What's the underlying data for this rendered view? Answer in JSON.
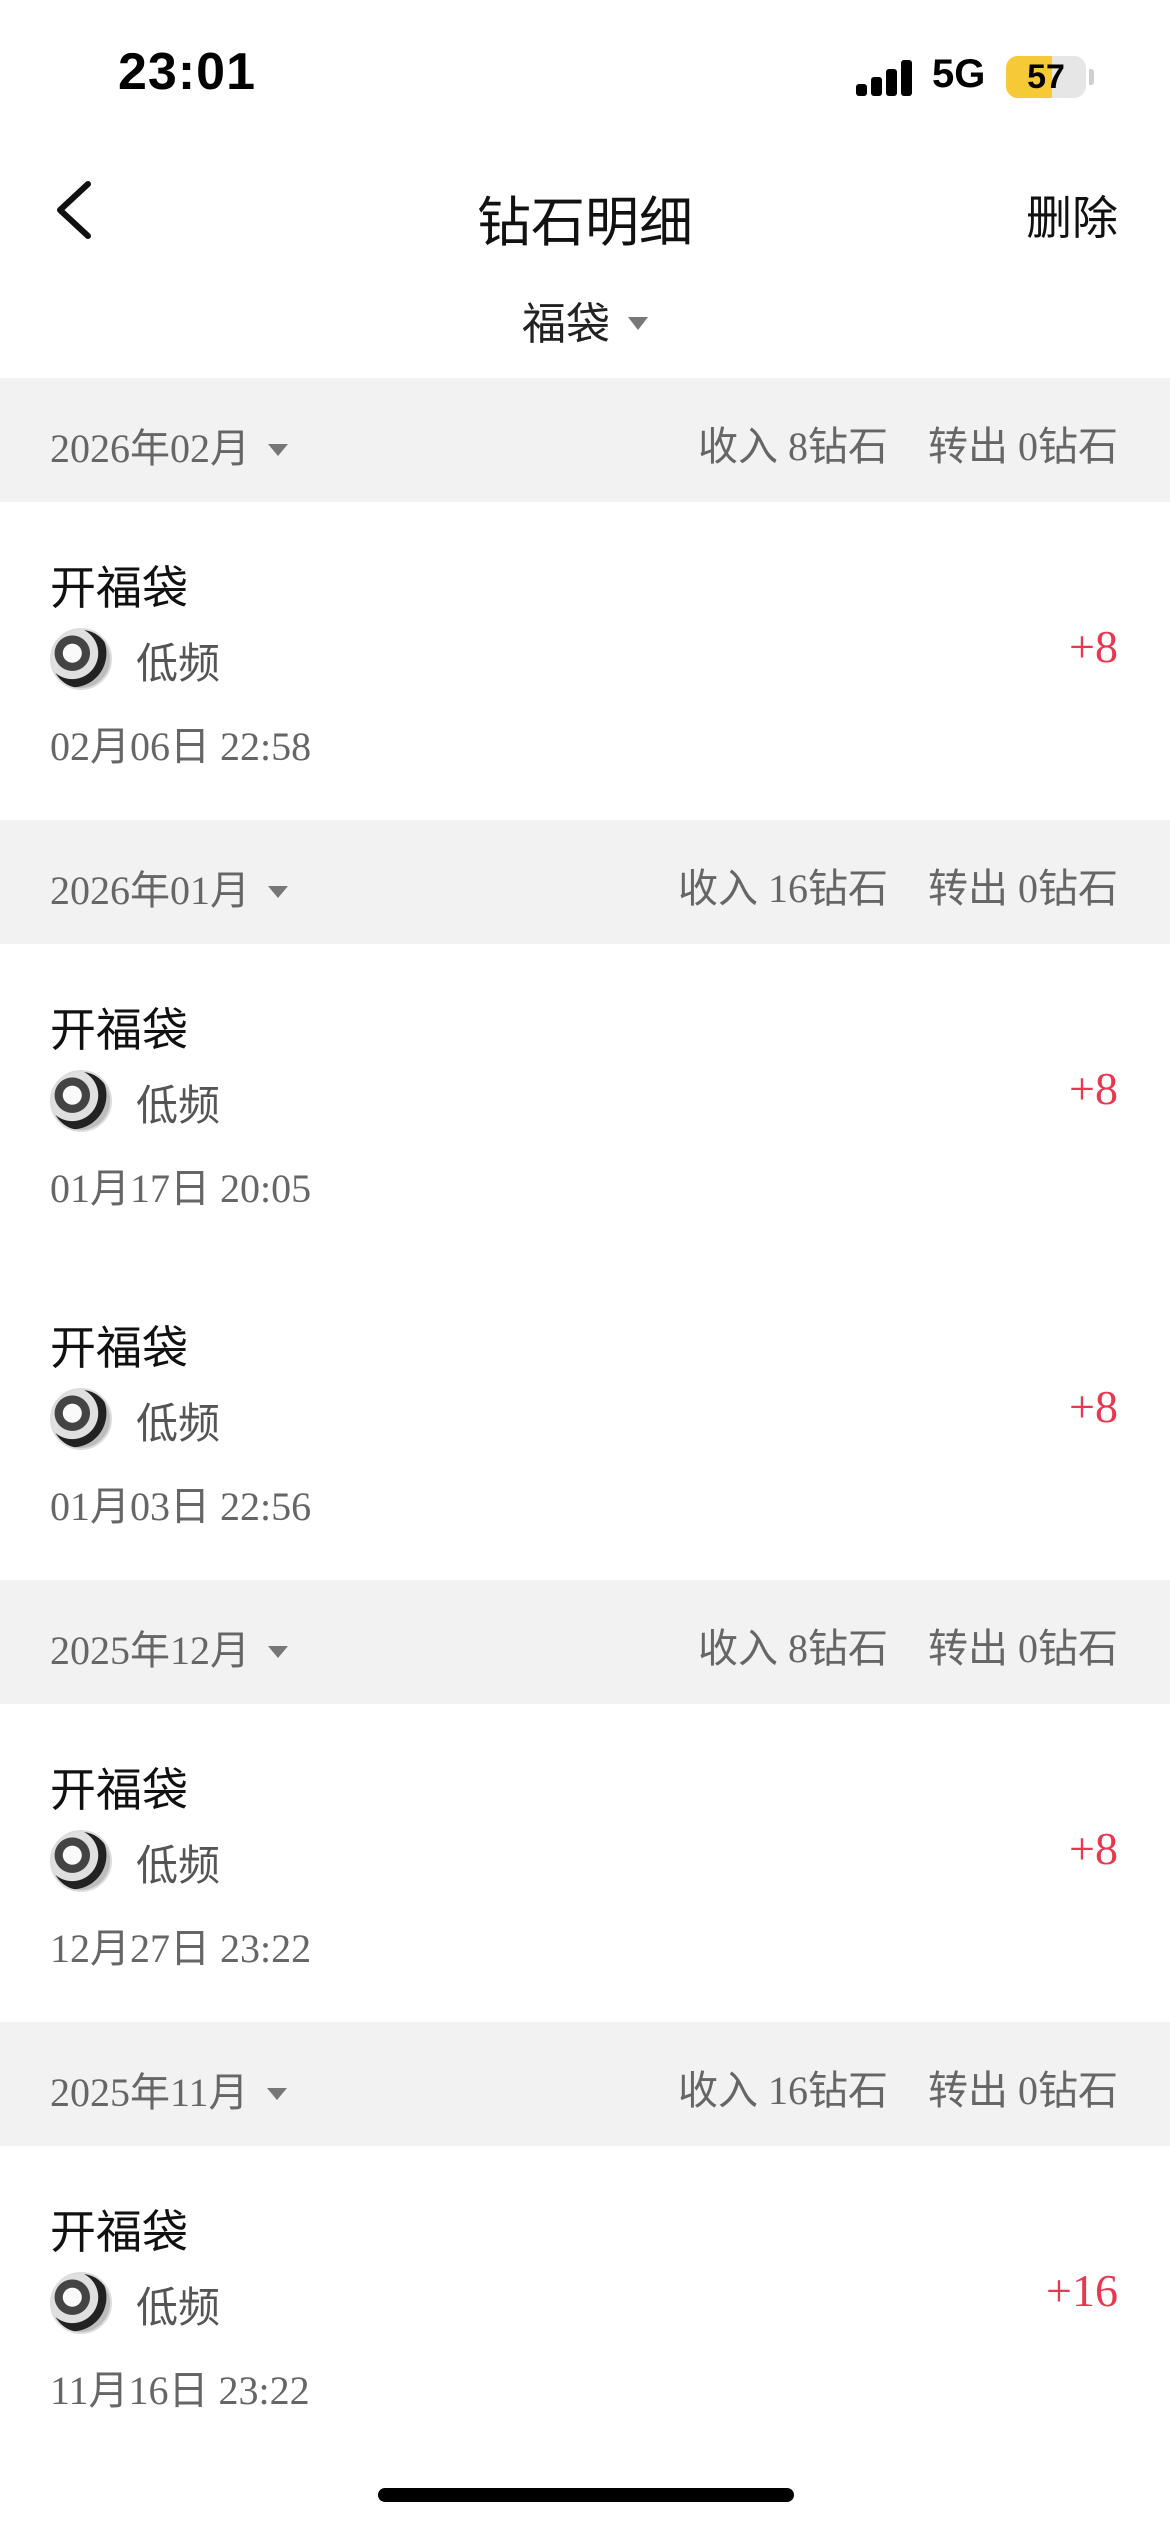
{
  "status_bar": {
    "time": "23:01",
    "network": "5G",
    "battery": "57",
    "battery_level": 0.57,
    "battery_color": "#f6c937"
  },
  "nav": {
    "back_icon": "chevron-left-icon",
    "title": "钻石明细",
    "delete_label": "删除"
  },
  "filter": {
    "label": "福袋"
  },
  "accent_color": "#e8374f",
  "months": [
    {
      "label": "2026年02月",
      "income": "收入 8钻石",
      "outgoing": "转出 0钻石",
      "records": [
        {
          "title": "开福袋",
          "user": "低频",
          "time": "02月06日 22:58",
          "amount": "+8"
        }
      ]
    },
    {
      "label": "2026年01月",
      "income": "收入 16钻石",
      "outgoing": "转出 0钻石",
      "records": [
        {
          "title": "开福袋",
          "user": "低频",
          "time": "01月17日 20:05",
          "amount": "+8"
        },
        {
          "title": "开福袋",
          "user": "低频",
          "time": "01月03日 22:56",
          "amount": "+8"
        }
      ]
    },
    {
      "label": "2025年12月",
      "income": "收入 8钻石",
      "outgoing": "转出 0钻石",
      "records": [
        {
          "title": "开福袋",
          "user": "低频",
          "time": "12月27日 23:22",
          "amount": "+8"
        }
      ]
    },
    {
      "label": "2025年11月",
      "income": "收入 16钻石",
      "outgoing": "转出 0钻石",
      "records": [
        {
          "title": "开福袋",
          "user": "低频",
          "time": "11月16日 23:22",
          "amount": "+16"
        }
      ]
    }
  ]
}
